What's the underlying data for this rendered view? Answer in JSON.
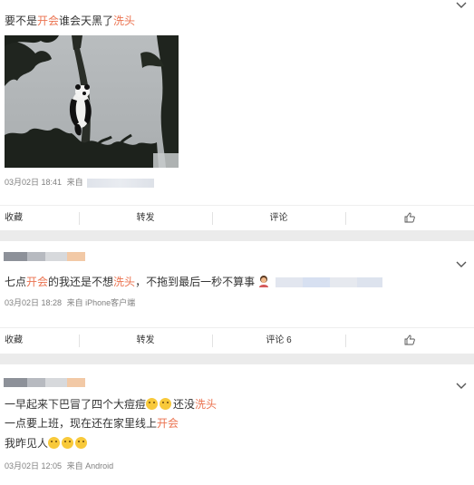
{
  "posts": [
    {
      "text_parts": [
        "要不是",
        "开会",
        "谁会天黑了",
        "洗头"
      ],
      "meta_date": "03月02日 18:41",
      "meta_source_prefix": "来自",
      "meta_source": ""
    },
    {
      "text_parts": [
        "七点",
        "开会",
        "的我还是不想",
        "洗头",
        "，不拖到最后一秒不算事"
      ],
      "meta_date": "03月02日 18:28",
      "meta_source_prefix": "来自",
      "meta_source": "iPhone客户端"
    },
    {
      "line1_parts": [
        "一早起来下巴冒了四个大痘痘",
        "还没",
        "洗头"
      ],
      "line2_parts": [
        "一点要上班，现在还在家里线上",
        "开会"
      ],
      "line3_parts": [
        "我昨见人"
      ],
      "meta_date": "03月02日 12:05",
      "meta_source_prefix": "来自",
      "meta_source": "Android"
    }
  ],
  "actions_1": {
    "collect": "收藏",
    "forward": "转发",
    "comment": "评论",
    "like_icon": "thumbs-up-icon"
  },
  "actions_2": {
    "collect": "收藏",
    "forward": "转发",
    "comment": "评论 6",
    "like_icon": "thumbs-up-icon"
  },
  "icons": {
    "expand": "chevron-down-icon",
    "emoji": "thinking-face-emoji"
  },
  "colors": {
    "highlight": "#eb7350",
    "meta": "#808080",
    "background": "#ebebeb"
  }
}
